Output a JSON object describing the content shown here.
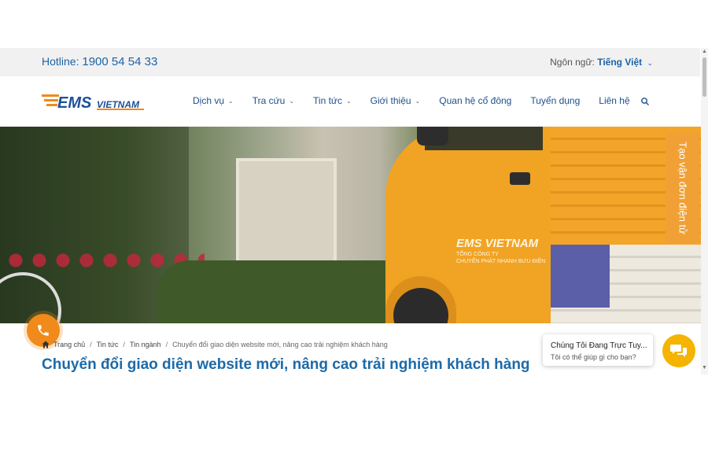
{
  "topbar": {
    "hotline_label": "Hotline:",
    "hotline_number": "1900 54 54 33",
    "language_label": "Ngôn ngữ:",
    "language_value": "Tiếng Việt"
  },
  "header": {
    "logo_text": "EMS",
    "logo_sub": "VIETNAM",
    "nav": [
      {
        "label": "Dịch vụ"
      },
      {
        "label": "Tra cứu"
      },
      {
        "label": "Tin tức"
      },
      {
        "label": "Giới thiệu"
      },
      {
        "label": "Quan hệ cổ đông"
      },
      {
        "label": "Tuyển dụng"
      },
      {
        "label": "Liên hệ"
      }
    ]
  },
  "hero": {
    "truck_logo": "EMS VIETNAM",
    "truck_line1": "TỔNG CÔNG TY",
    "truck_line2": "CHUYỂN PHÁT NHANH BƯU ĐIỆN"
  },
  "side_tab": {
    "label": "Tạo vận đơn điện tử"
  },
  "breadcrumb": {
    "items": [
      "Trang chủ",
      "Tin tức",
      "Tin ngành"
    ],
    "current": "Chuyển đổi giao diện website mới, nâng cao trải nghiệm khách hàng"
  },
  "page": {
    "title": "Chuyển đổi giao diện website mới, nâng cao trải nghiệm khách hàng"
  },
  "chat": {
    "title": "Chúng Tôi Đang Trực Tuy...",
    "subtitle": "Tôi có thể giúp gì cho bạn?"
  },
  "colors": {
    "brand_blue": "#1c63a6",
    "brand_orange": "#f08a1b",
    "chat_yellow": "#f4b400"
  }
}
